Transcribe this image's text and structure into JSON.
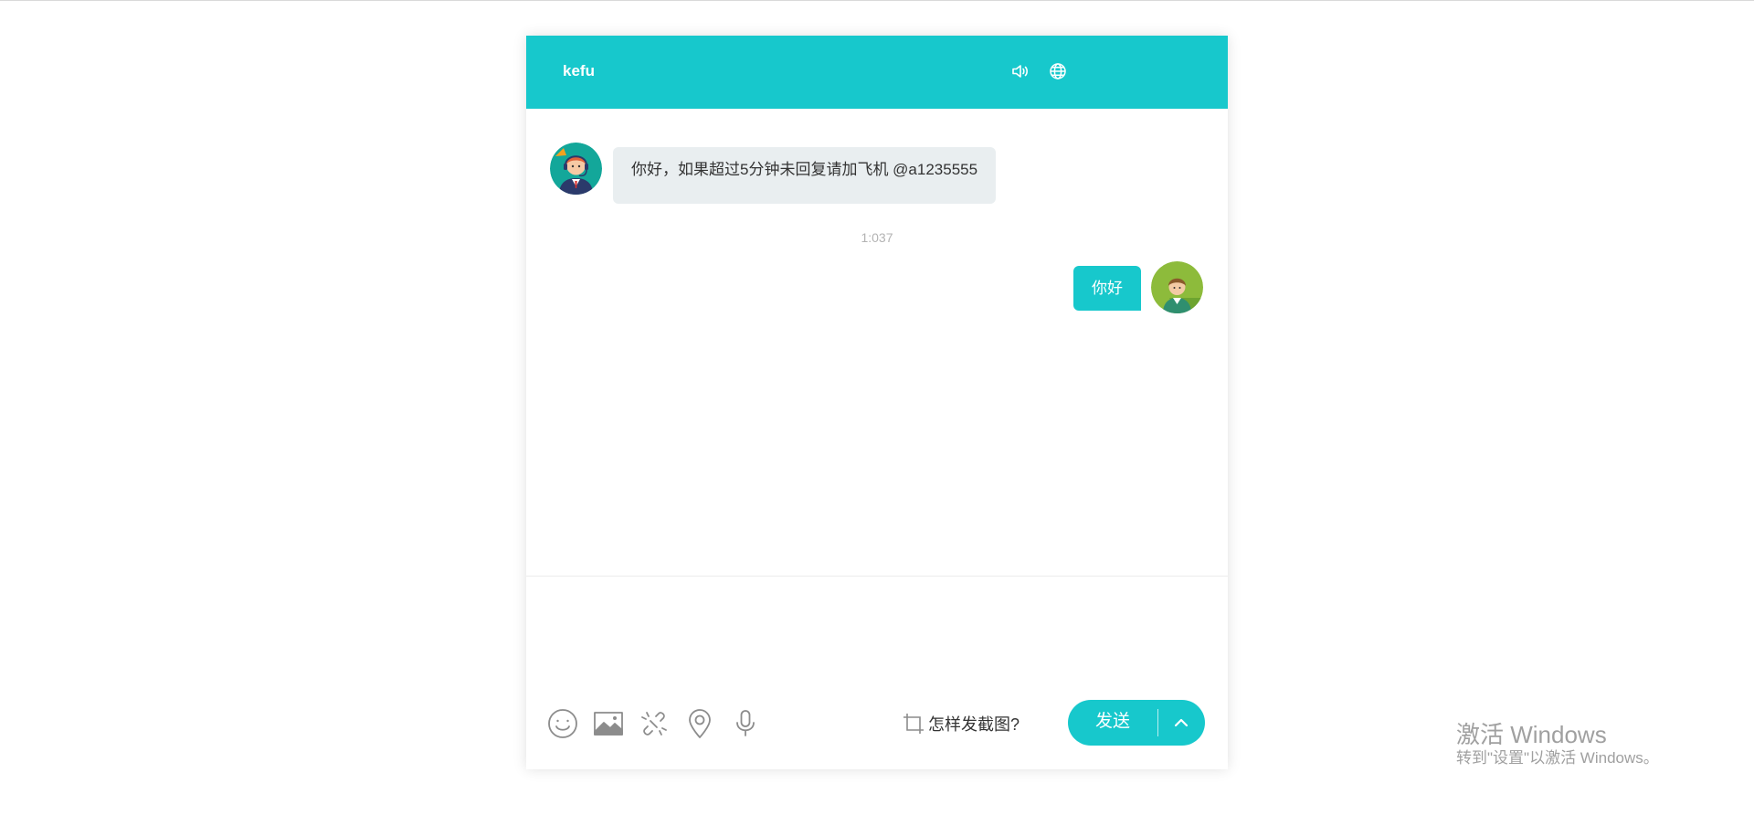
{
  "header": {
    "title": "kefu",
    "sound_icon": "speaker-icon",
    "language_icon": "globe-icon"
  },
  "messages": [
    {
      "direction": "incoming",
      "avatar": "agent-avatar",
      "text": "你好，如果超过5分钟未回复请加飞机 @a1235555"
    },
    {
      "type": "timestamp",
      "text": "1:037"
    },
    {
      "direction": "outgoing",
      "avatar": "user-avatar",
      "text": "你好"
    }
  ],
  "input": {
    "value": "",
    "placeholder": ""
  },
  "toolbar": {
    "icons": [
      "emoji-icon",
      "image-icon",
      "link-icon",
      "location-icon",
      "microphone-icon"
    ],
    "screenshot_help_label": "怎样发截图?",
    "send_label": "发送",
    "send_options_icon": "chevron-up-icon"
  },
  "watermark": {
    "title": "激活 Windows",
    "subtitle": "转到\"设置\"以激活 Windows。"
  },
  "colors": {
    "accent": "#17c8cc",
    "incoming_bubble": "#e9eef0",
    "background": "#ffffff"
  }
}
